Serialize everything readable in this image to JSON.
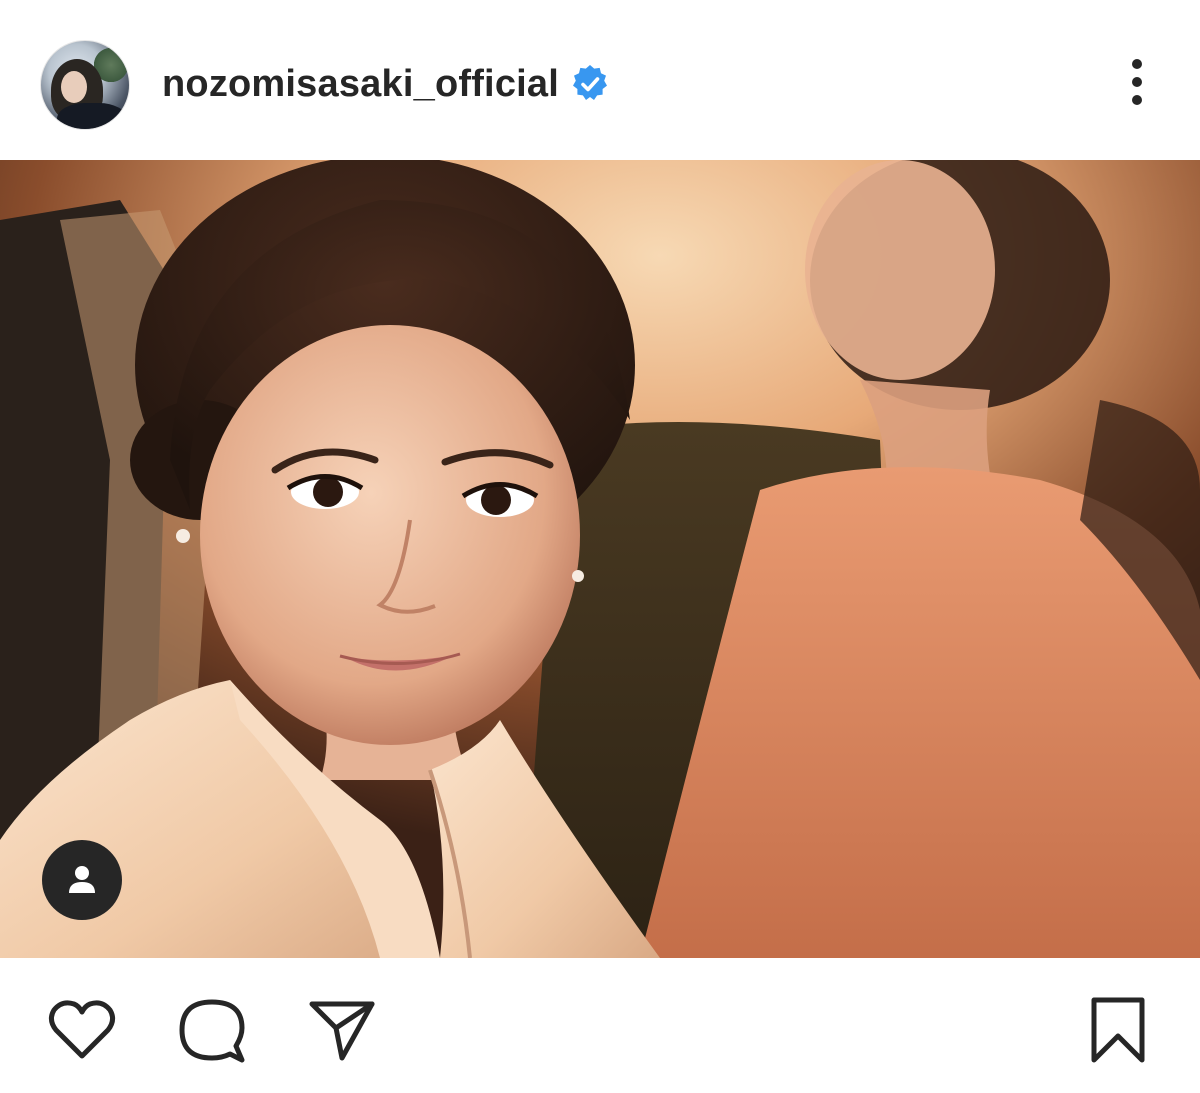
{
  "post": {
    "username": "nozomisasaki_official",
    "verified": true,
    "colors": {
      "text": "#262626",
      "verified_badge": "#3897f0",
      "icon": "#262626"
    }
  },
  "header": {
    "avatar_icon": "profile-avatar",
    "verified_icon": "verified-badge-icon",
    "more_icon": "more-options-icon"
  },
  "photo": {
    "tag_icon": "user-tag-icon"
  },
  "actions": {
    "like_icon": "heart-icon",
    "comment_icon": "comment-icon",
    "share_icon": "paper-plane-icon",
    "save_icon": "bookmark-icon"
  }
}
